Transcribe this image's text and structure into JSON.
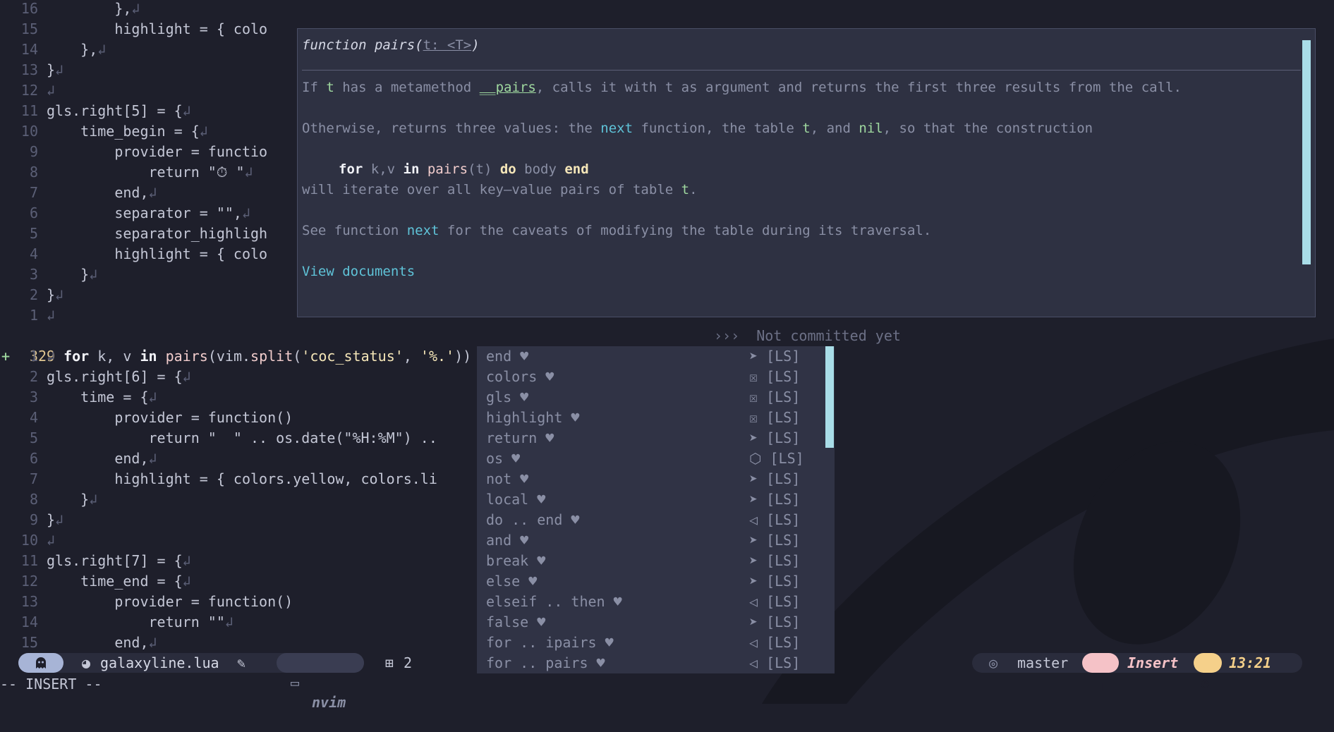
{
  "editor": {
    "top_lines": [
      {
        "ln": "16",
        "text": "        },"
      },
      {
        "ln": "15",
        "text": "        highlight = { colo"
      },
      {
        "ln": "14",
        "text": "    },"
      },
      {
        "ln": "13",
        "text": "}"
      },
      {
        "ln": "12",
        "text": ""
      },
      {
        "ln": "11",
        "text": "gls.right[5] = {"
      },
      {
        "ln": "10",
        "text": "    time_begin = {"
      },
      {
        "ln": "9",
        "text": "        provider = functio"
      },
      {
        "ln": "8",
        "text": "            return \"⏱ \""
      },
      {
        "ln": "7",
        "text": "        end,"
      },
      {
        "ln": "6",
        "text": "        separator = \"\","
      },
      {
        "ln": "5",
        "text": "        separator_highligh"
      },
      {
        "ln": "4",
        "text": "        highlight = { colo"
      },
      {
        "ln": "3",
        "text": "    }"
      },
      {
        "ln": "2",
        "text": "}"
      },
      {
        "ln": "1",
        "text": ""
      }
    ],
    "current_line": {
      "marker": "+",
      "ln": "329",
      "text": "for k, v in pairs(vim.split('coc_status', '%.')) do print(k .. v); end",
      "blame": "›››  Not committed yet"
    },
    "bottom_lines": [
      {
        "ln": "1",
        "marker": "+",
        "text": ""
      },
      {
        "ln": "2",
        "text": "gls.right[6] = {"
      },
      {
        "ln": "3",
        "text": "    time = {"
      },
      {
        "ln": "4",
        "text": "        provider = function()"
      },
      {
        "ln": "5",
        "text": "            return \"  \" .. os.date(\"%H:%M\") .."
      },
      {
        "ln": "6",
        "text": "        end,"
      },
      {
        "ln": "7",
        "text": "        highlight = { colors.yellow, colors.li"
      },
      {
        "ln": "8",
        "text": "    }"
      },
      {
        "ln": "9",
        "text": "}"
      },
      {
        "ln": "10",
        "text": ""
      },
      {
        "ln": "11",
        "text": "gls.right[7] = {"
      },
      {
        "ln": "12",
        "text": "    time_end = {"
      },
      {
        "ln": "13",
        "text": "        provider = function()"
      },
      {
        "ln": "14",
        "text": "            return \"\""
      },
      {
        "ln": "15",
        "text": "        end,"
      }
    ]
  },
  "hover_doc": {
    "signature_prefix": "function pairs(",
    "signature_param": "t: <T>",
    "signature_suffix": ")",
    "para1_a": "If ",
    "para1_t": "t",
    "para1_b": " has a metamethod ",
    "para1_meta": "__pairs",
    "para1_c": ", calls it with t as argument and returns the first three results from the call.",
    "para2_a": "Otherwise, returns three values: the ",
    "para2_next": "next",
    "para2_b": " function, the table ",
    "para2_t": "t",
    "para2_c": ", and ",
    "para2_nil": "nil",
    "para2_d": ", so that the construction",
    "code_for": "for",
    "code_kv": " k,v ",
    "code_in": "in",
    "code_pairs": " pairs",
    "code_arg": "(t) ",
    "code_do": "do",
    "code_body": " body ",
    "code_end": "end",
    "para3_a": "will iterate over all key–value pairs of table ",
    "para3_t": "t",
    "para3_b": ".",
    "para4_a": "See function ",
    "para4_next": "next",
    "para4_b": " for the caveats of modifying the table during its traversal.",
    "link": "View documents"
  },
  "completion": {
    "items": [
      {
        "label": "end",
        "kind": "keyword-icon",
        "source": "[LS]"
      },
      {
        "label": "colors",
        "kind": "variable-icon",
        "source": "[LS]"
      },
      {
        "label": "gls",
        "kind": "variable-icon",
        "source": "[LS]"
      },
      {
        "label": "highlight",
        "kind": "variable-icon",
        "source": "[LS]"
      },
      {
        "label": "return",
        "kind": "keyword-icon",
        "source": "[LS]"
      },
      {
        "label": "os",
        "kind": "module-icon",
        "source": "[LS]"
      },
      {
        "label": "not",
        "kind": "keyword-icon",
        "source": "[LS]"
      },
      {
        "label": "local",
        "kind": "keyword-icon",
        "source": "[LS]"
      },
      {
        "label": "do .. end",
        "kind": "snippet-icon",
        "source": "[LS]"
      },
      {
        "label": "and",
        "kind": "keyword-icon",
        "source": "[LS]"
      },
      {
        "label": "break",
        "kind": "keyword-icon",
        "source": "[LS]"
      },
      {
        "label": "else",
        "kind": "keyword-icon",
        "source": "[LS]"
      },
      {
        "label": "elseif .. then",
        "kind": "snippet-icon",
        "source": "[LS]"
      },
      {
        "label": "false",
        "kind": "keyword-icon",
        "source": "[LS]"
      },
      {
        "label": "for .. ipairs",
        "kind": "snippet-icon",
        "source": "[LS]"
      },
      {
        "label": "for .. pairs",
        "kind": "snippet-icon",
        "source": "[LS]"
      }
    ],
    "scroll_fraction": 0.31
  },
  "statusline": {
    "filename": "galaxyline.lua",
    "dir": "nvim",
    "diff_count": "2",
    "branch": "master",
    "mode": "Insert",
    "time": "13:21",
    "colors": {
      "bar_bg": "#2a2c3c",
      "ghost_bg": "#a7b4d6",
      "mode_icon_bg": "#f5c2c7",
      "time_icon_bg": "#f5d08a",
      "time_fg": "#f5d08a"
    }
  },
  "modeline": "-- INSERT --"
}
